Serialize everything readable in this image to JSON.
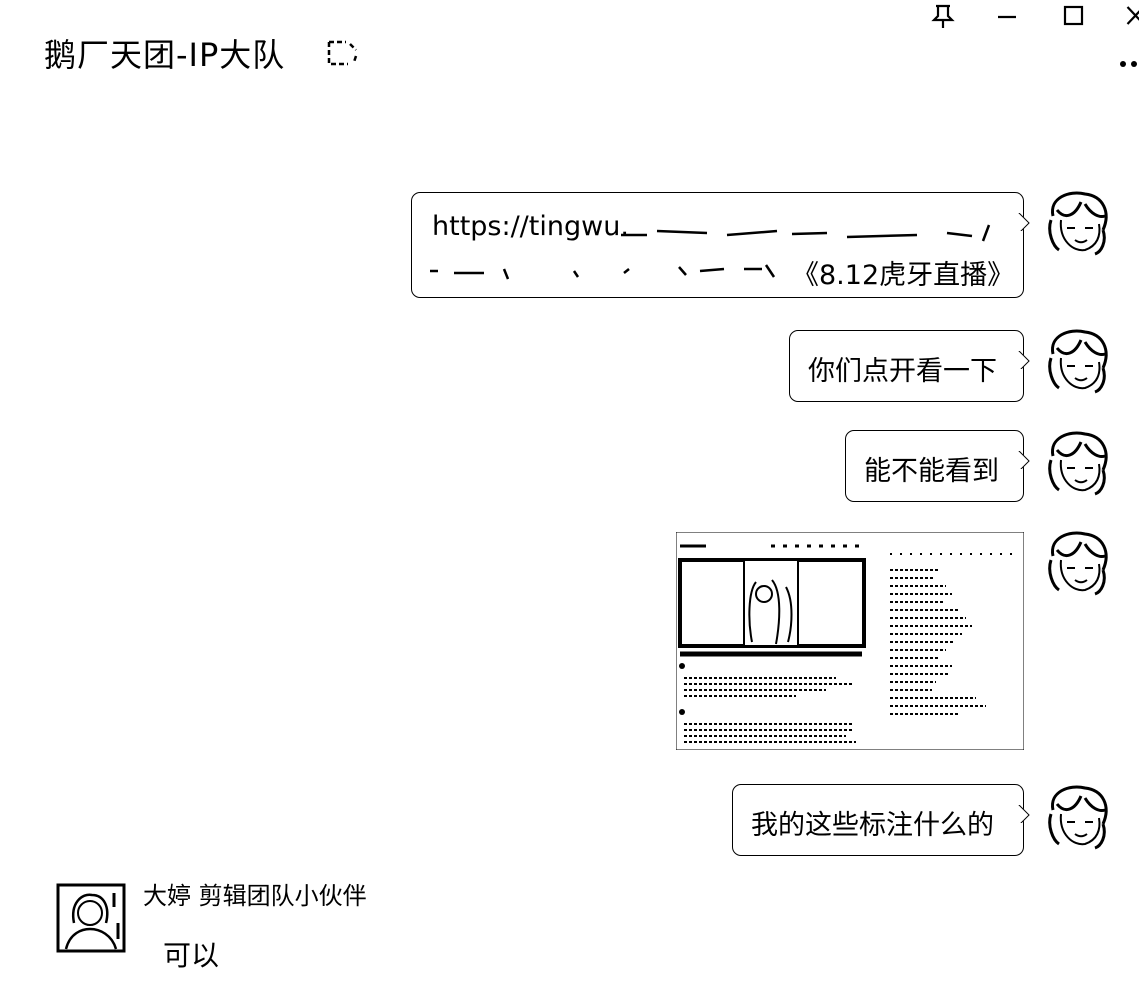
{
  "header": {
    "title": "鹅厂天团-IP大队",
    "window_controls": [
      "pin-icon",
      "minimize-icon",
      "maximize-icon",
      "close-icon"
    ],
    "more_icon": "more-dots-icon"
  },
  "messages": [
    {
      "type": "text",
      "line1": "https://tingwu.",
      "line2_tail": "《8.12虎牙直播》"
    },
    {
      "type": "text",
      "text": "你们点开看一下"
    },
    {
      "type": "text",
      "text": "能不能看到"
    },
    {
      "type": "image",
      "description_icon": "screenshot-thumbnail"
    },
    {
      "type": "text",
      "text": "我的这些标注什么的"
    }
  ],
  "incoming": {
    "sender": "大婷 剪辑团队小伙伴",
    "text": "可以"
  }
}
